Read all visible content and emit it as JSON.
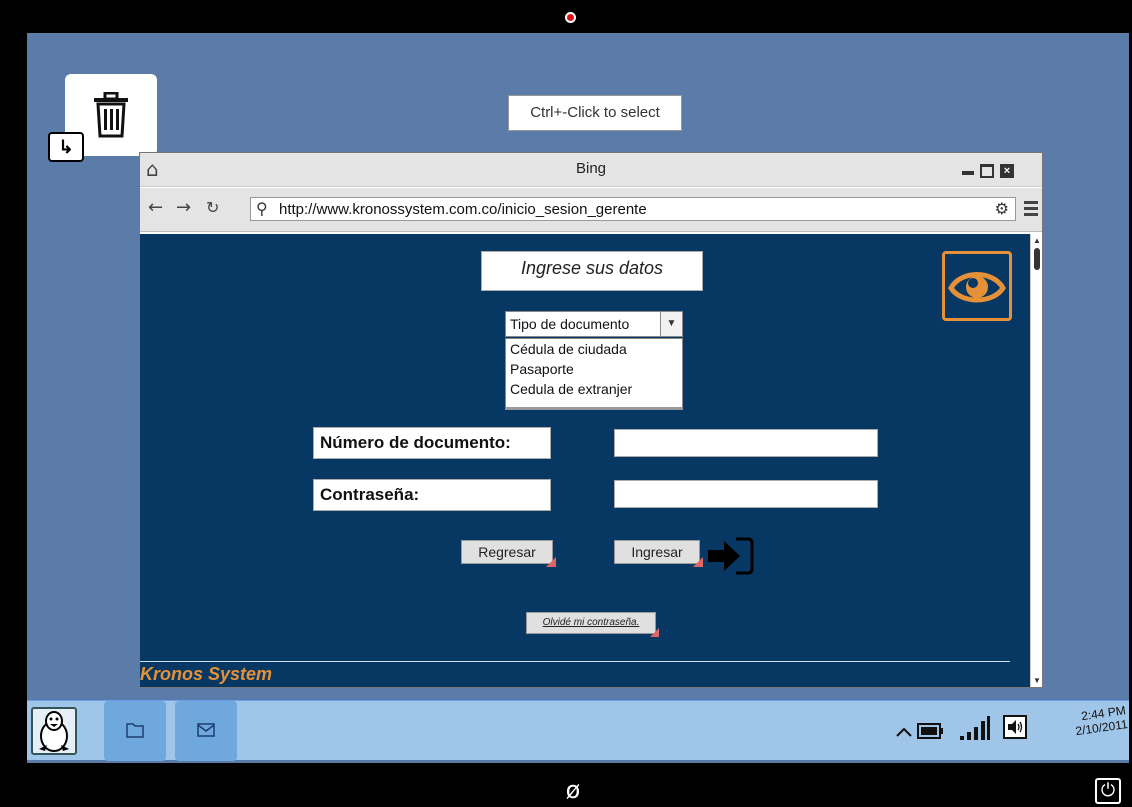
{
  "device": {
    "power_glyph": "⏻",
    "home_glyph": "ø"
  },
  "desktop": {
    "trash_icon": "trash-icon",
    "tooltip": "Ctrl+-Click to select"
  },
  "browser": {
    "title": "Bing",
    "url": "http://www.kronossystem.com.co/inicio_sesion_gerente"
  },
  "page": {
    "heading": "Ingrese sus datos",
    "doc_type": {
      "selected": "Tipo de documento",
      "options": [
        "Cédula de ciudada",
        "Pasaporte",
        "Cedula de extranjer"
      ]
    },
    "fields": {
      "doc_number_label": "Número de documento:",
      "doc_number_value": "",
      "password_label": "Contraseña:",
      "password_value": ""
    },
    "buttons": {
      "back": "Regresar",
      "login": "Ingresar",
      "forgot": "Olvidé mi contraseña."
    },
    "footer_brand": "Kronos System",
    "colors": {
      "page_bg": "#073763",
      "accent": "#e69138"
    }
  },
  "taskbar": {
    "clock_time": "2:44 PM",
    "clock_date": "2/10/2011"
  }
}
